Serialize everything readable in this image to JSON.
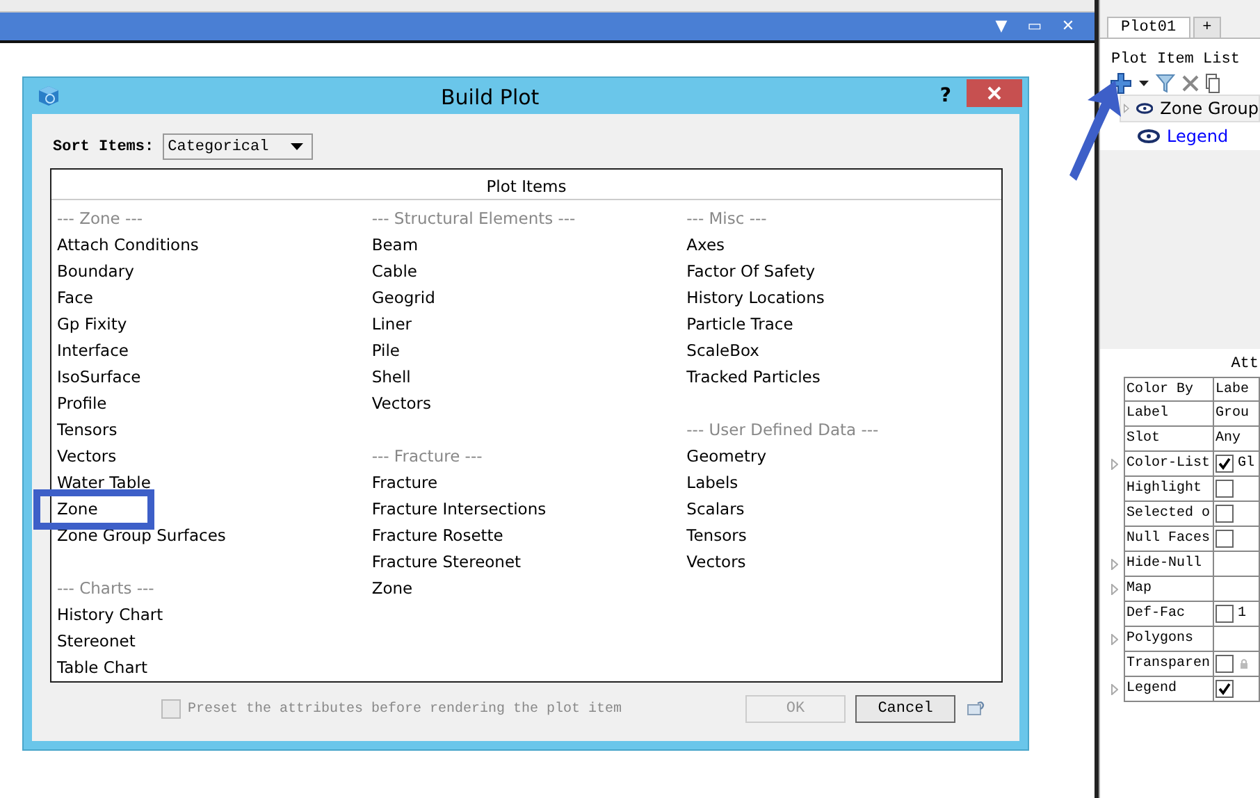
{
  "main_window": {
    "controls": [
      "▼",
      "▭",
      "✕"
    ]
  },
  "dialog": {
    "title": "Build Plot",
    "help": "?",
    "sort_label": "Sort Items:",
    "sort_value": "Categorical",
    "list_header": "Plot Items",
    "columns": [
      {
        "groups": [
          {
            "header": "--- Zone ---",
            "items": [
              "Attach Conditions",
              "Boundary",
              "Face",
              "Gp Fixity",
              "Interface",
              "IsoSurface",
              "Profile",
              "Tensors",
              "Vectors",
              "Water Table",
              "Zone",
              "Zone Group Surfaces"
            ]
          },
          {
            "header": "--- Charts ---",
            "items": [
              "History Chart",
              "Stereonet",
              "Table Chart"
            ]
          }
        ]
      },
      {
        "groups": [
          {
            "header": "--- Structural Elements ---",
            "items": [
              "Beam",
              "Cable",
              "Geogrid",
              "Liner",
              "Pile",
              "Shell",
              "Vectors"
            ]
          },
          {
            "header": "--- Fracture ---",
            "items": [
              "Fracture",
              "Fracture Intersections",
              "Fracture Rosette",
              "Fracture Stereonet",
              "Zone"
            ]
          }
        ]
      },
      {
        "groups": [
          {
            "header": "--- Misc ---",
            "items": [
              "Axes",
              "Factor Of Safety",
              "History Locations",
              "Particle Trace",
              "ScaleBox",
              "Tracked Particles"
            ]
          },
          {
            "header": "--- User Defined Data ---",
            "items": [
              "Geometry",
              "Labels",
              "Scalars",
              "Tensors",
              "Vectors"
            ]
          }
        ]
      }
    ],
    "preset": {
      "label": "Preset the attributes before rendering the plot item",
      "checked": false,
      "disabled": true
    },
    "buttons": [
      {
        "label": "OK",
        "disabled": true
      },
      {
        "label": "Cancel",
        "disabled": false
      }
    ]
  },
  "side_panel": {
    "tabs": [
      {
        "label": "Plot01",
        "selected": true
      },
      {
        "label": "+",
        "selected": false
      }
    ],
    "list_label": "Plot Item List",
    "items": [
      {
        "label": "Zone Group",
        "selected": true,
        "color": "#000000"
      },
      {
        "label": "Legend",
        "selected": false,
        "color": "#0000ff"
      }
    ],
    "attributes_header": "Att",
    "attributes": [
      {
        "name": "Color By",
        "expandable": false,
        "kind": "text",
        "value": "Labe"
      },
      {
        "name": "Label",
        "expandable": false,
        "kind": "text",
        "value": "Grou"
      },
      {
        "name": "Slot",
        "expandable": false,
        "kind": "text",
        "value": "Any"
      },
      {
        "name": "Color-List",
        "expandable": true,
        "kind": "checkbox",
        "checked": true,
        "value": "Gl"
      },
      {
        "name": "Highlight",
        "expandable": false,
        "kind": "checkbox",
        "checked": false
      },
      {
        "name": "Selected o",
        "expandable": false,
        "kind": "checkbox",
        "checked": false
      },
      {
        "name": "Null Faces",
        "expandable": false,
        "kind": "checkbox",
        "checked": false
      },
      {
        "name": "Hide-Null",
        "expandable": true,
        "kind": "empty"
      },
      {
        "name": "Map",
        "expandable": true,
        "kind": "empty"
      },
      {
        "name": "Def-Fac",
        "expandable": false,
        "kind": "checkbox",
        "checked": false,
        "value": "1"
      },
      {
        "name": "Polygons",
        "expandable": true,
        "kind": "empty"
      },
      {
        "name": "Transparen",
        "expandable": false,
        "kind": "checkbox",
        "checked": false,
        "locked": true
      },
      {
        "name": "Legend",
        "expandable": true,
        "kind": "checkbox",
        "checked": true
      }
    ]
  },
  "annotations": {
    "highlight": true,
    "arrow": true
  }
}
